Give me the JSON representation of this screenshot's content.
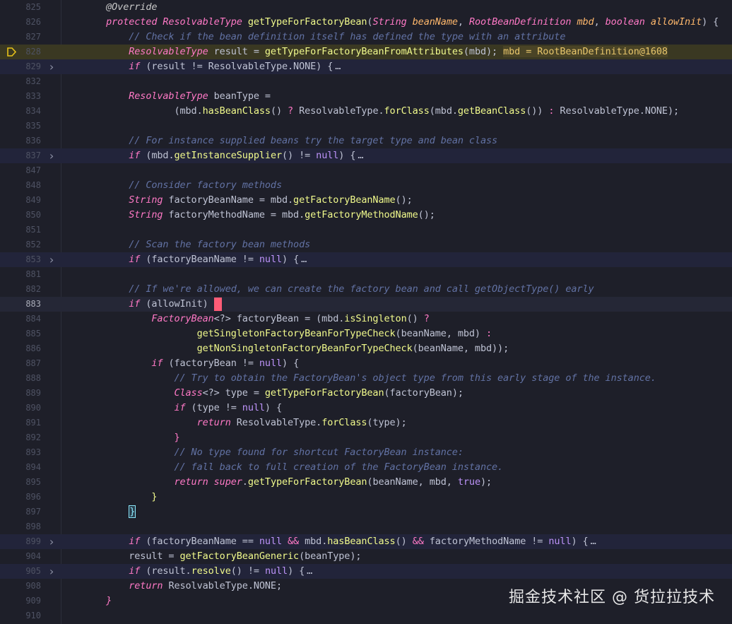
{
  "editor": {
    "lines": [
      {
        "n": "825",
        "fold": "",
        "bp": false,
        "hl": "",
        "segs": [
          [
            "    ",
            "t-plain"
          ],
          [
            "@Override",
            "t-ann"
          ]
        ]
      },
      {
        "n": "826",
        "fold": "",
        "bp": false,
        "hl": "",
        "segs": [
          [
            "    ",
            "t-plain"
          ],
          [
            "protected ",
            "t-kw"
          ],
          [
            "ResolvableType ",
            "t-cls"
          ],
          [
            "getTypeForFactoryBean",
            "t-fn"
          ],
          [
            "(",
            "t-plain"
          ],
          [
            "String ",
            "t-str-t"
          ],
          [
            "beanName",
            "t-param"
          ],
          [
            ", ",
            "t-plain"
          ],
          [
            "RootBeanDefinition ",
            "t-cls"
          ],
          [
            "mbd",
            "t-param"
          ],
          [
            ", ",
            "t-plain"
          ],
          [
            "boolean ",
            "t-kw"
          ],
          [
            "allowInit",
            "t-param"
          ],
          [
            ") { ",
            "t-plain"
          ]
        ]
      },
      {
        "n": "827",
        "fold": "",
        "bp": false,
        "hl": "",
        "segs": [
          [
            "        ",
            "t-plain"
          ],
          [
            "// Check if the bean definition itself has defined the type with an attribute",
            "t-cm"
          ]
        ]
      },
      {
        "n": "828",
        "fold": "",
        "bp": true,
        "hl": "hl",
        "segs": [
          [
            "        ",
            "t-plain"
          ],
          [
            "ResolvableType ",
            "t-cls"
          ],
          [
            "result = ",
            "t-plain"
          ],
          [
            "getTypeForFactoryBeanFromAttributes",
            "t-fn"
          ],
          [
            "(mbd); ",
            "t-plain"
          ],
          [
            "mbd = RootBeanDefinition@1608",
            "t-inline"
          ]
        ]
      },
      {
        "n": "829",
        "fold": ">",
        "bp": false,
        "hl": "fold-row",
        "segs": [
          [
            "        ",
            "t-plain"
          ],
          [
            "if ",
            "t-kw"
          ],
          [
            "(result != ResolvableType.NONE) {",
            "t-plain"
          ],
          [
            "…",
            "t-fold"
          ]
        ]
      },
      {
        "n": "832",
        "fold": "",
        "bp": false,
        "hl": "",
        "segs": []
      },
      {
        "n": "833",
        "fold": "",
        "bp": false,
        "hl": "",
        "segs": [
          [
            "        ",
            "t-plain"
          ],
          [
            "ResolvableType ",
            "t-cls"
          ],
          [
            "beanType =",
            "t-plain"
          ]
        ]
      },
      {
        "n": "834",
        "fold": "",
        "bp": false,
        "hl": "",
        "segs": [
          [
            "                ",
            "t-plain"
          ],
          [
            "(mbd.",
            "t-plain"
          ],
          [
            "hasBeanClass",
            "t-fn"
          ],
          [
            "() ",
            "t-plain"
          ],
          [
            "? ",
            "t-op"
          ],
          [
            "ResolvableType.",
            "t-plain"
          ],
          [
            "forClass",
            "t-fn"
          ],
          [
            "(mbd.",
            "t-plain"
          ],
          [
            "getBeanClass",
            "t-fn"
          ],
          [
            "()) ",
            "t-plain"
          ],
          [
            ": ",
            "t-op"
          ],
          [
            "ResolvableType.NONE);",
            "t-plain"
          ]
        ]
      },
      {
        "n": "835",
        "fold": "",
        "bp": false,
        "hl": "",
        "segs": []
      },
      {
        "n": "836",
        "fold": "",
        "bp": false,
        "hl": "",
        "segs": [
          [
            "        ",
            "t-plain"
          ],
          [
            "// For instance supplied beans try the target type and bean class",
            "t-cm"
          ]
        ]
      },
      {
        "n": "837",
        "fold": ">",
        "bp": false,
        "hl": "fold-row",
        "segs": [
          [
            "        ",
            "t-plain"
          ],
          [
            "if ",
            "t-kw"
          ],
          [
            "(mbd.",
            "t-plain"
          ],
          [
            "getInstanceSupplier",
            "t-fn"
          ],
          [
            "() != ",
            "t-plain"
          ],
          [
            "null",
            "t-lit"
          ],
          [
            ") {",
            "t-plain"
          ],
          [
            "…",
            "t-fold"
          ]
        ]
      },
      {
        "n": "847",
        "fold": "",
        "bp": false,
        "hl": "",
        "segs": []
      },
      {
        "n": "848",
        "fold": "",
        "bp": false,
        "hl": "",
        "segs": [
          [
            "        ",
            "t-plain"
          ],
          [
            "// Consider factory methods",
            "t-cm"
          ]
        ]
      },
      {
        "n": "849",
        "fold": "",
        "bp": false,
        "hl": "",
        "segs": [
          [
            "        ",
            "t-plain"
          ],
          [
            "String ",
            "t-str-t"
          ],
          [
            "factoryBeanName = mbd.",
            "t-plain"
          ],
          [
            "getFactoryBeanName",
            "t-fn"
          ],
          [
            "();",
            "t-plain"
          ]
        ]
      },
      {
        "n": "850",
        "fold": "",
        "bp": false,
        "hl": "",
        "segs": [
          [
            "        ",
            "t-plain"
          ],
          [
            "String ",
            "t-str-t"
          ],
          [
            "factoryMethodName = mbd.",
            "t-plain"
          ],
          [
            "getFactoryMethodName",
            "t-fn"
          ],
          [
            "();",
            "t-plain"
          ]
        ]
      },
      {
        "n": "851",
        "fold": "",
        "bp": false,
        "hl": "",
        "segs": []
      },
      {
        "n": "852",
        "fold": "",
        "bp": false,
        "hl": "",
        "segs": [
          [
            "        ",
            "t-plain"
          ],
          [
            "// Scan the factory bean methods",
            "t-cm"
          ]
        ]
      },
      {
        "n": "853",
        "fold": ">",
        "bp": false,
        "hl": "fold-row",
        "segs": [
          [
            "        ",
            "t-plain"
          ],
          [
            "if ",
            "t-kw"
          ],
          [
            "(factoryBeanName != ",
            "t-plain"
          ],
          [
            "null",
            "t-lit"
          ],
          [
            ") {",
            "t-plain"
          ],
          [
            "…",
            "t-fold"
          ]
        ]
      },
      {
        "n": "881",
        "fold": "",
        "bp": false,
        "hl": "",
        "segs": []
      },
      {
        "n": "882",
        "fold": "",
        "bp": false,
        "hl": "",
        "segs": [
          [
            "        ",
            "t-plain"
          ],
          [
            "// If we're allowed, we can create the factory bean and call getObjectType() early",
            "t-cm"
          ]
        ]
      },
      {
        "n": "883",
        "fold": "",
        "bp": false,
        "hl": "caret-row",
        "caret": true,
        "segs": [
          [
            "        ",
            "t-plain"
          ],
          [
            "if ",
            "t-kw"
          ],
          [
            "(allowInit)",
            "t-plain"
          ]
        ]
      },
      {
        "n": "884",
        "fold": "",
        "bp": false,
        "hl": "",
        "segs": [
          [
            "            ",
            "t-plain"
          ],
          [
            "FactoryBean",
            "t-cls"
          ],
          [
            "<?> factoryBean = (mbd.",
            "t-plain"
          ],
          [
            "isSingleton",
            "t-fn"
          ],
          [
            "() ",
            "t-plain"
          ],
          [
            "?",
            "t-op"
          ]
        ]
      },
      {
        "n": "885",
        "fold": "",
        "bp": false,
        "hl": "",
        "segs": [
          [
            "                    ",
            "t-plain"
          ],
          [
            "getSingletonFactoryBeanForTypeCheck",
            "t-fn"
          ],
          [
            "(beanName, mbd) ",
            "t-plain"
          ],
          [
            ":",
            "t-op"
          ]
        ]
      },
      {
        "n": "886",
        "fold": "",
        "bp": false,
        "hl": "",
        "segs": [
          [
            "                    ",
            "t-plain"
          ],
          [
            "getNonSingletonFactoryBeanForTypeCheck",
            "t-fn"
          ],
          [
            "(beanName, mbd));",
            "t-plain"
          ]
        ]
      },
      {
        "n": "887",
        "fold": "",
        "bp": false,
        "hl": "",
        "segs": [
          [
            "            ",
            "t-plain"
          ],
          [
            "if ",
            "t-kw"
          ],
          [
            "(factoryBean != ",
            "t-plain"
          ],
          [
            "null",
            "t-lit"
          ],
          [
            ") {",
            "t-plain"
          ]
        ]
      },
      {
        "n": "888",
        "fold": "",
        "bp": false,
        "hl": "",
        "segs": [
          [
            "                ",
            "t-plain"
          ],
          [
            "// Try to obtain the FactoryBean's object type from this early stage of the instance.",
            "t-cm"
          ]
        ]
      },
      {
        "n": "889",
        "fold": "",
        "bp": false,
        "hl": "",
        "segs": [
          [
            "                ",
            "t-plain"
          ],
          [
            "Class",
            "t-cls"
          ],
          [
            "<?> type = ",
            "t-plain"
          ],
          [
            "getTypeForFactoryBean",
            "t-fn"
          ],
          [
            "(factoryBean);",
            "t-plain"
          ]
        ]
      },
      {
        "n": "890",
        "fold": "",
        "bp": false,
        "hl": "",
        "segs": [
          [
            "                ",
            "t-plain"
          ],
          [
            "if ",
            "t-kw"
          ],
          [
            "(type != ",
            "t-plain"
          ],
          [
            "null",
            "t-lit"
          ],
          [
            ") {",
            "t-plain"
          ]
        ]
      },
      {
        "n": "891",
        "fold": "",
        "bp": false,
        "hl": "",
        "segs": [
          [
            "                    ",
            "t-plain"
          ],
          [
            "return ",
            "t-kw"
          ],
          [
            "ResolvableType.",
            "t-plain"
          ],
          [
            "forClass",
            "t-fn"
          ],
          [
            "(type);",
            "t-plain"
          ]
        ]
      },
      {
        "n": "892",
        "fold": "",
        "bp": false,
        "hl": "",
        "segs": [
          [
            "                ",
            "t-plain"
          ],
          [
            "}",
            "t-op"
          ]
        ]
      },
      {
        "n": "893",
        "fold": "",
        "bp": false,
        "hl": "",
        "segs": [
          [
            "                ",
            "t-plain"
          ],
          [
            "// No type found for shortcut FactoryBean instance:",
            "t-cm"
          ]
        ]
      },
      {
        "n": "894",
        "fold": "",
        "bp": false,
        "hl": "",
        "segs": [
          [
            "                ",
            "t-plain"
          ],
          [
            "// fall back to full creation of the FactoryBean instance.",
            "t-cm"
          ]
        ]
      },
      {
        "n": "895",
        "fold": "",
        "bp": false,
        "hl": "",
        "segs": [
          [
            "                ",
            "t-plain"
          ],
          [
            "return ",
            "t-kw"
          ],
          [
            "super",
            "t-kw"
          ],
          [
            ".",
            "t-plain"
          ],
          [
            "getTypeForFactoryBean",
            "t-fn"
          ],
          [
            "(beanName, mbd, ",
            "t-plain"
          ],
          [
            "true",
            "t-lit"
          ],
          [
            ");",
            "t-plain"
          ]
        ]
      },
      {
        "n": "896",
        "fold": "",
        "bp": false,
        "hl": "",
        "segs": [
          [
            "            ",
            "t-plain"
          ],
          [
            "}",
            "t-fn"
          ]
        ]
      },
      {
        "n": "897",
        "fold": "",
        "bp": false,
        "hl": "",
        "segs": [
          [
            "        ",
            "t-plain"
          ],
          [
            "}",
            "t-brace"
          ]
        ]
      },
      {
        "n": "898",
        "fold": "",
        "bp": false,
        "hl": "",
        "segs": []
      },
      {
        "n": "899",
        "fold": ">",
        "bp": false,
        "hl": "fold-row",
        "segs": [
          [
            "        ",
            "t-plain"
          ],
          [
            "if ",
            "t-kw"
          ],
          [
            "(factoryBeanName == ",
            "t-plain"
          ],
          [
            "null ",
            "t-lit"
          ],
          [
            "&& ",
            "t-op"
          ],
          [
            "mbd.",
            "t-plain"
          ],
          [
            "hasBeanClass",
            "t-fn"
          ],
          [
            "() ",
            "t-plain"
          ],
          [
            "&& ",
            "t-op"
          ],
          [
            "factoryMethodName != ",
            "t-plain"
          ],
          [
            "null",
            "t-lit"
          ],
          [
            ") {",
            "t-plain"
          ],
          [
            "…",
            "t-fold"
          ]
        ]
      },
      {
        "n": "904",
        "fold": "",
        "bp": false,
        "hl": "",
        "segs": [
          [
            "        ",
            "t-plain"
          ],
          [
            "result = ",
            "t-plain"
          ],
          [
            "getFactoryBeanGeneric",
            "t-fn"
          ],
          [
            "(beanType);",
            "t-plain"
          ]
        ]
      },
      {
        "n": "905",
        "fold": ">",
        "bp": false,
        "hl": "fold-row",
        "segs": [
          [
            "        ",
            "t-plain"
          ],
          [
            "if ",
            "t-kw"
          ],
          [
            "(result.",
            "t-plain"
          ],
          [
            "resolve",
            "t-fn"
          ],
          [
            "() != ",
            "t-plain"
          ],
          [
            "null",
            "t-lit"
          ],
          [
            ") {",
            "t-plain"
          ],
          [
            "…",
            "t-fold"
          ]
        ]
      },
      {
        "n": "908",
        "fold": "",
        "bp": false,
        "hl": "",
        "segs": [
          [
            "        ",
            "t-plain"
          ],
          [
            "return ",
            "t-kw"
          ],
          [
            "ResolvableType.NONE;",
            "t-plain"
          ]
        ]
      },
      {
        "n": "909",
        "fold": "",
        "bp": false,
        "hl": "",
        "segs": [
          [
            "    ",
            "t-plain"
          ],
          [
            "}",
            "t-kw"
          ]
        ]
      },
      {
        "n": "910",
        "fold": "",
        "bp": false,
        "hl": "",
        "segs": []
      }
    ]
  },
  "watermark": "掘金技术社区 @ 货拉拉技术",
  "colors": {
    "background": "#1e1f29",
    "keyword": "#ff79c6",
    "function": "#f1fa8c",
    "comment": "#6272a4",
    "literal": "#bd93f9",
    "parameter": "#ffb86c",
    "breakpoint_line": "#3a3822",
    "caret": "#ff5c77"
  },
  "icons": {
    "breakpoint": "debug-execution-point-icon",
    "fold": "chevron-right-icon"
  }
}
